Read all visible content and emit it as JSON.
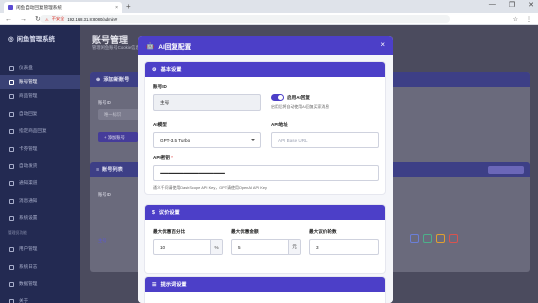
{
  "browser": {
    "tab_title": "闲鱼自动回复管理系统",
    "tab_close": "×",
    "new_tab": "+",
    "window_buttons": [
      "—",
      "❐",
      "✕"
    ],
    "nav": [
      "←",
      "→",
      "↻"
    ],
    "security_label": "不安全",
    "url": "192.168.31.8:8080/admin#",
    "right_icons": [
      "☆",
      "⋮"
    ]
  },
  "sidebar": {
    "title": "闲鱼管理系统",
    "items": [
      {
        "label": "仪表盘",
        "icon": "dashboard-icon"
      },
      {
        "label": "账号管理",
        "icon": "account-icon",
        "active": true
      },
      {
        "label": "商品管理",
        "icon": "product-icon"
      },
      {
        "label": "自动回复",
        "icon": "reply-icon"
      },
      {
        "label": "指定商品回复",
        "icon": "reply-icon"
      },
      {
        "label": "卡券管理",
        "icon": "card-icon"
      },
      {
        "label": "自动发货",
        "icon": "delivery-icon"
      },
      {
        "label": "通知渠道",
        "icon": "bell-icon"
      },
      {
        "label": "消息通知",
        "icon": "message-icon"
      },
      {
        "label": "系统设置",
        "icon": "gear-icon"
      }
    ],
    "group_label": "管理员功能",
    "admin_items": [
      {
        "label": "用户管理",
        "icon": "users-icon"
      },
      {
        "label": "系统日志",
        "icon": "log-icon"
      },
      {
        "label": "数据管理",
        "icon": "database-icon"
      },
      {
        "label": "关于",
        "icon": "info-icon"
      }
    ]
  },
  "background": {
    "page_title": "账号管理",
    "page_subtitle": "管理闲鱼账号Cookie信息",
    "add_card_title": "添加新账号",
    "account_id_label": "账号ID",
    "account_id_placeholder": "唯一标识",
    "add_button": "+ 添加账号",
    "list_card_title": "账号列表",
    "col_account_id": "账号ID",
    "row_account": "主号"
  },
  "modal": {
    "title": "AI回复配置",
    "close": "×",
    "basic_section": {
      "title": "基本设置",
      "account_label": "账号ID",
      "account_value": "主号",
      "enable_label": "启用AI回复",
      "enable_hint": "启用后将自动使用AI回复买家消息",
      "enabled": true,
      "model_label": "AI模型",
      "model_value": "GPT-3.5 Turbo",
      "api_url_label": "API地址",
      "api_url_placeholder": "API Base URL",
      "api_key_label": "API密钥",
      "api_key_required": "*",
      "api_key_value": "••••••••••••••••••••••••••••••••••••••••••••••••••••••••••••••••",
      "api_key_hint": "通义千问请使用DashScope API Key，GPT请使用OpenAI API Key"
    },
    "bargain_section": {
      "title": "议价设置",
      "max_discount_pct_label": "最大优惠百分比",
      "max_discount_pct_value": "10",
      "max_discount_pct_unit": "%",
      "max_discount_amount_label": "最大优惠金额",
      "max_discount_amount_value": "5",
      "max_discount_amount_unit": "元",
      "max_rounds_label": "最大议价轮数",
      "max_rounds_value": "3"
    },
    "prompt_section": {
      "title": "提示词设置"
    }
  },
  "colors": {
    "primary": "#4c3fc8",
    "sidebar": "#232a52"
  }
}
